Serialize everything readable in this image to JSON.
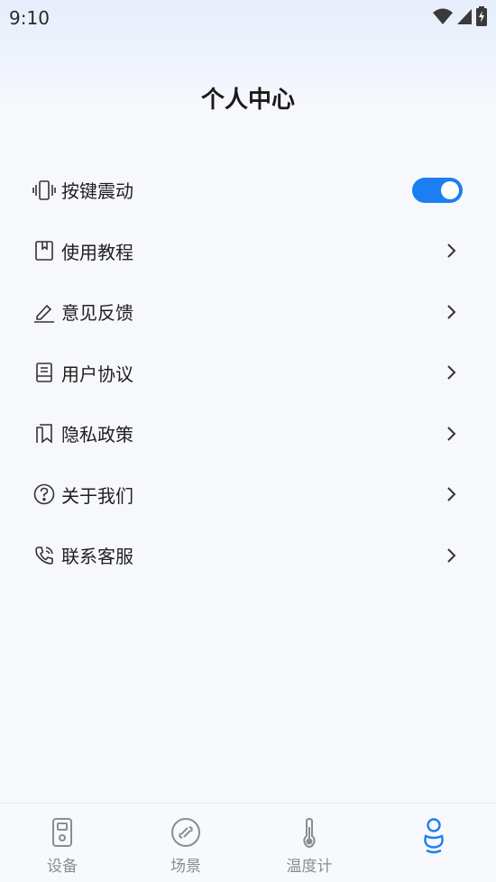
{
  "status": {
    "time": "9:10"
  },
  "header": {
    "title": "个人中心"
  },
  "menu": [
    {
      "label": "按键震动",
      "icon": "vibrate-icon",
      "type": "toggle",
      "enabled": true
    },
    {
      "label": "使用教程",
      "icon": "bookmark-book-icon",
      "type": "link"
    },
    {
      "label": "意见反馈",
      "icon": "pencil-icon",
      "type": "link"
    },
    {
      "label": "用户协议",
      "icon": "document-icon",
      "type": "link"
    },
    {
      "label": "隐私政策",
      "icon": "pages-icon",
      "type": "link"
    },
    {
      "label": "关于我们",
      "icon": "question-circle-icon",
      "type": "link"
    },
    {
      "label": "联系客服",
      "icon": "phone-icon",
      "type": "link"
    }
  ],
  "tabs": [
    {
      "label": "设备",
      "icon": "device-icon",
      "active": false
    },
    {
      "label": "场景",
      "icon": "scene-icon",
      "active": false
    },
    {
      "label": "温度计",
      "icon": "thermometer-icon",
      "active": false
    },
    {
      "label": "",
      "icon": "profile-icon",
      "active": true
    }
  ],
  "colors": {
    "accent": "#1b7ff2",
    "icon": "#333333",
    "tab_inactive": "#8a8d93"
  }
}
